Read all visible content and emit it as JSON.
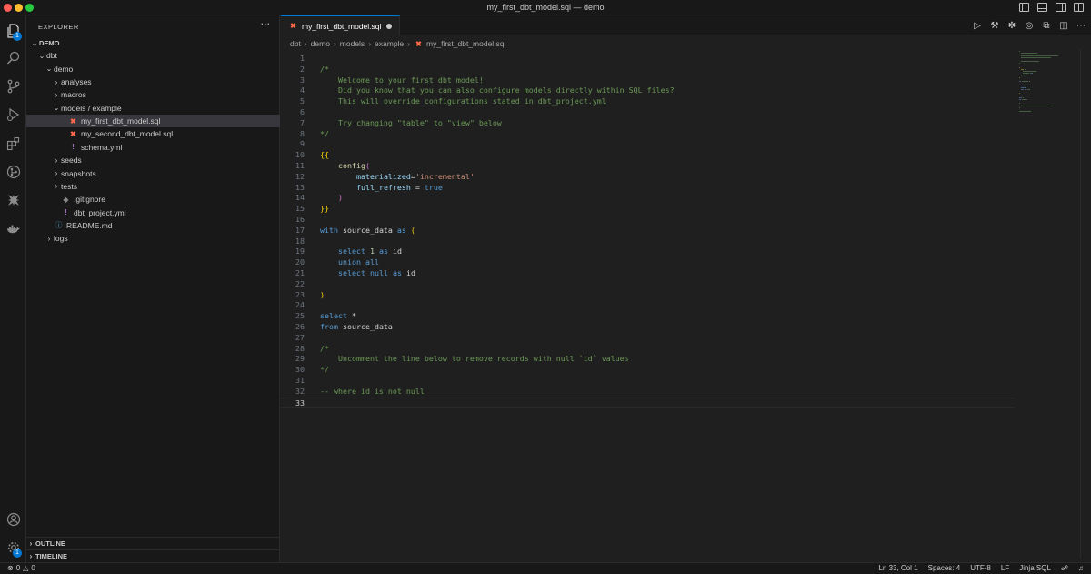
{
  "window": {
    "title": "my_first_dbt_model.sql — demo"
  },
  "activity_bar": {
    "explorer_badge": "1",
    "settings_badge": "1"
  },
  "sidebar": {
    "header": "EXPLORER",
    "more_label": "···",
    "tree": [
      {
        "label": "DEMO",
        "chevron": "⌄",
        "indent": 0,
        "icon": "",
        "icon_name": ""
      },
      {
        "label": "dbt",
        "chevron": "⌄",
        "indent": 1,
        "icon": "",
        "icon_name": ""
      },
      {
        "label": "demo",
        "chevron": "⌄",
        "indent": 2,
        "icon": "",
        "icon_name": ""
      },
      {
        "label": "analyses",
        "chevron": "›",
        "indent": 3,
        "icon": "",
        "icon_name": ""
      },
      {
        "label": "macros",
        "chevron": "›",
        "indent": 3,
        "icon": "",
        "icon_name": ""
      },
      {
        "label": "models / example",
        "chevron": "⌄",
        "indent": 3,
        "icon": "",
        "icon_name": ""
      },
      {
        "label": "my_first_dbt_model.sql",
        "chevron": "",
        "indent": 4,
        "icon": "✖",
        "icon_name": "dbt-file-icon",
        "active": true
      },
      {
        "label": "my_second_dbt_model.sql",
        "chevron": "",
        "indent": 4,
        "icon": "✖",
        "icon_name": "dbt-file-icon"
      },
      {
        "label": "schema.yml",
        "chevron": "",
        "indent": 4,
        "icon": "!",
        "icon_name": "yaml-file-icon"
      },
      {
        "label": "seeds",
        "chevron": "›",
        "indent": 3,
        "icon": "",
        "icon_name": ""
      },
      {
        "label": "snapshots",
        "chevron": "›",
        "indent": 3,
        "icon": "",
        "icon_name": ""
      },
      {
        "label": "tests",
        "chevron": "›",
        "indent": 3,
        "icon": "",
        "icon_name": ""
      },
      {
        "label": ".gitignore",
        "chevron": "",
        "indent": 3,
        "icon": "◆",
        "icon_name": "gitignore-file-icon"
      },
      {
        "label": "dbt_project.yml",
        "chevron": "",
        "indent": 3,
        "icon": "!",
        "icon_name": "yaml-file-icon"
      },
      {
        "label": "README.md",
        "chevron": "",
        "indent": 2,
        "icon": "ⓘ",
        "icon_name": "readme-file-icon"
      },
      {
        "label": "logs",
        "chevron": "›",
        "indent": 2,
        "icon": "",
        "icon_name": ""
      }
    ],
    "outline_label": "OUTLINE",
    "timeline_label": "TIMELINE"
  },
  "editor": {
    "tab_label": "my_first_dbt_model.sql",
    "breadcrumb": [
      "dbt",
      "demo",
      "models",
      "example",
      "my_first_dbt_model.sql"
    ],
    "current_line": 33,
    "lines": [
      [],
      [
        [
          "/*",
          "c-com"
        ]
      ],
      [
        [
          "    Welcome to your first dbt model!",
          "c-com"
        ]
      ],
      [
        [
          "    Did you know that you can also configure models directly within SQL files?",
          "c-com"
        ]
      ],
      [
        [
          "    This will override configurations stated in dbt_project.yml",
          "c-com"
        ]
      ],
      [],
      [
        [
          "    Try changing \"table\" to \"view\" below",
          "c-com"
        ]
      ],
      [
        [
          "*/",
          "c-com"
        ]
      ],
      [],
      [
        [
          "{{",
          "c-brace"
        ]
      ],
      [
        [
          "    ",
          "c-id"
        ],
        [
          "config",
          "c-func"
        ],
        [
          "(",
          "c-paren2"
        ]
      ],
      [
        [
          "        ",
          "c-id"
        ],
        [
          "materialized",
          "c-name"
        ],
        [
          "=",
          "c-id"
        ],
        [
          "'incremental'",
          "c-str"
        ]
      ],
      [
        [
          "        ",
          "c-id"
        ],
        [
          "full_refresh",
          "c-name"
        ],
        [
          " = ",
          "c-id"
        ],
        [
          "true",
          "c-lit"
        ]
      ],
      [
        [
          "    ",
          "c-id"
        ],
        [
          ")",
          "c-paren2"
        ]
      ],
      [
        [
          "}}",
          "c-brace"
        ]
      ],
      [],
      [
        [
          "with",
          "c-kw"
        ],
        [
          " source_data ",
          "c-id"
        ],
        [
          "as",
          "c-kw"
        ],
        [
          " ",
          "c-id"
        ],
        [
          "(",
          "c-brace"
        ]
      ],
      [],
      [
        [
          "    ",
          "c-id"
        ],
        [
          "select",
          "c-kw"
        ],
        [
          " ",
          "c-id"
        ],
        [
          "1",
          "c-num"
        ],
        [
          " ",
          "c-id"
        ],
        [
          "as",
          "c-kw"
        ],
        [
          " id",
          "c-id"
        ]
      ],
      [
        [
          "    ",
          "c-id"
        ],
        [
          "union all",
          "c-kw"
        ]
      ],
      [
        [
          "    ",
          "c-id"
        ],
        [
          "select",
          "c-kw"
        ],
        [
          " ",
          "c-id"
        ],
        [
          "null",
          "c-kw"
        ],
        [
          " ",
          "c-id"
        ],
        [
          "as",
          "c-kw"
        ],
        [
          " id",
          "c-id"
        ]
      ],
      [],
      [
        [
          ")",
          "c-brace"
        ]
      ],
      [],
      [
        [
          "select",
          "c-kw"
        ],
        [
          " *",
          "c-id"
        ]
      ],
      [
        [
          "from",
          "c-kw"
        ],
        [
          " source_data",
          "c-id"
        ]
      ],
      [],
      [
        [
          "/*",
          "c-com"
        ]
      ],
      [
        [
          "    Uncomment the line below to remove records with null `id` values",
          "c-com"
        ]
      ],
      [
        [
          "*/",
          "c-com"
        ]
      ],
      [],
      [
        [
          "-- where id is not null",
          "c-com"
        ]
      ],
      []
    ]
  },
  "status_bar": {
    "errors": "0",
    "warnings": "0",
    "position": "Ln 33, Col 1",
    "spaces": "Spaces: 4",
    "encoding": "UTF-8",
    "eol": "LF",
    "language": "Jinja SQL"
  }
}
